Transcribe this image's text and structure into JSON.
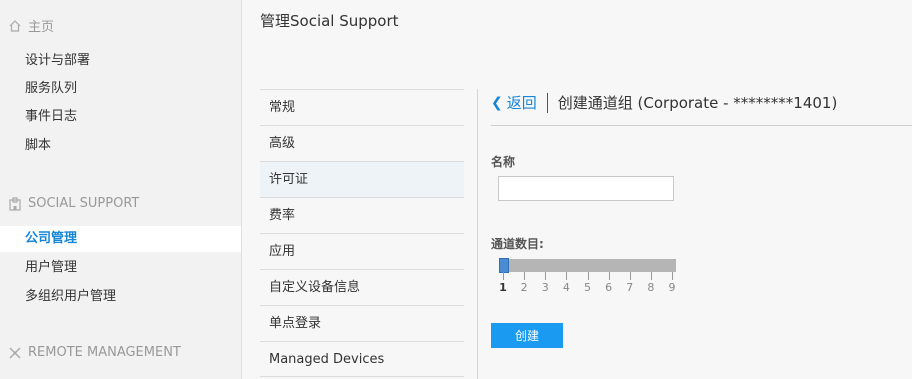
{
  "sidebar": {
    "home_section": {
      "label": "主页",
      "icon": "home-icon"
    },
    "home_items": [
      {
        "label": "设计与部署"
      },
      {
        "label": "服务队列"
      },
      {
        "label": "事件日志"
      },
      {
        "label": "脚本"
      }
    ],
    "social_section": {
      "label": "SOCIAL SUPPORT",
      "icon": "building-icon"
    },
    "social_items": [
      {
        "label": "公司管理",
        "active": true
      },
      {
        "label": "用户管理"
      },
      {
        "label": "多组织用户管理"
      }
    ],
    "remote_section": {
      "label": "REMOTE MANAGEMENT",
      "icon": "remote-icon"
    }
  },
  "header": {
    "title": "管理Social Support"
  },
  "settings_menu": {
    "items": [
      {
        "label": "常规"
      },
      {
        "label": "高级"
      },
      {
        "label": "许可证",
        "active": true
      },
      {
        "label": "费率"
      },
      {
        "label": "应用"
      },
      {
        "label": "自定义设备信息"
      },
      {
        "label": "单点登录"
      },
      {
        "label": "Managed Devices"
      }
    ]
  },
  "panel": {
    "back_label": "返回",
    "title": "创建通道组 (Corporate - ********1401)",
    "name_label": "名称",
    "name_value": "",
    "channels_label": "通道数目:",
    "slider": {
      "min": 1,
      "max": 9,
      "value": 1,
      "tick_labels": [
        "1",
        "2",
        "3",
        "4",
        "5",
        "6",
        "7",
        "8",
        "9"
      ]
    },
    "create_label": "创建"
  },
  "colors": {
    "accent": "#1585d8",
    "button": "#1a9af0",
    "handle": "#4a8bd1"
  }
}
